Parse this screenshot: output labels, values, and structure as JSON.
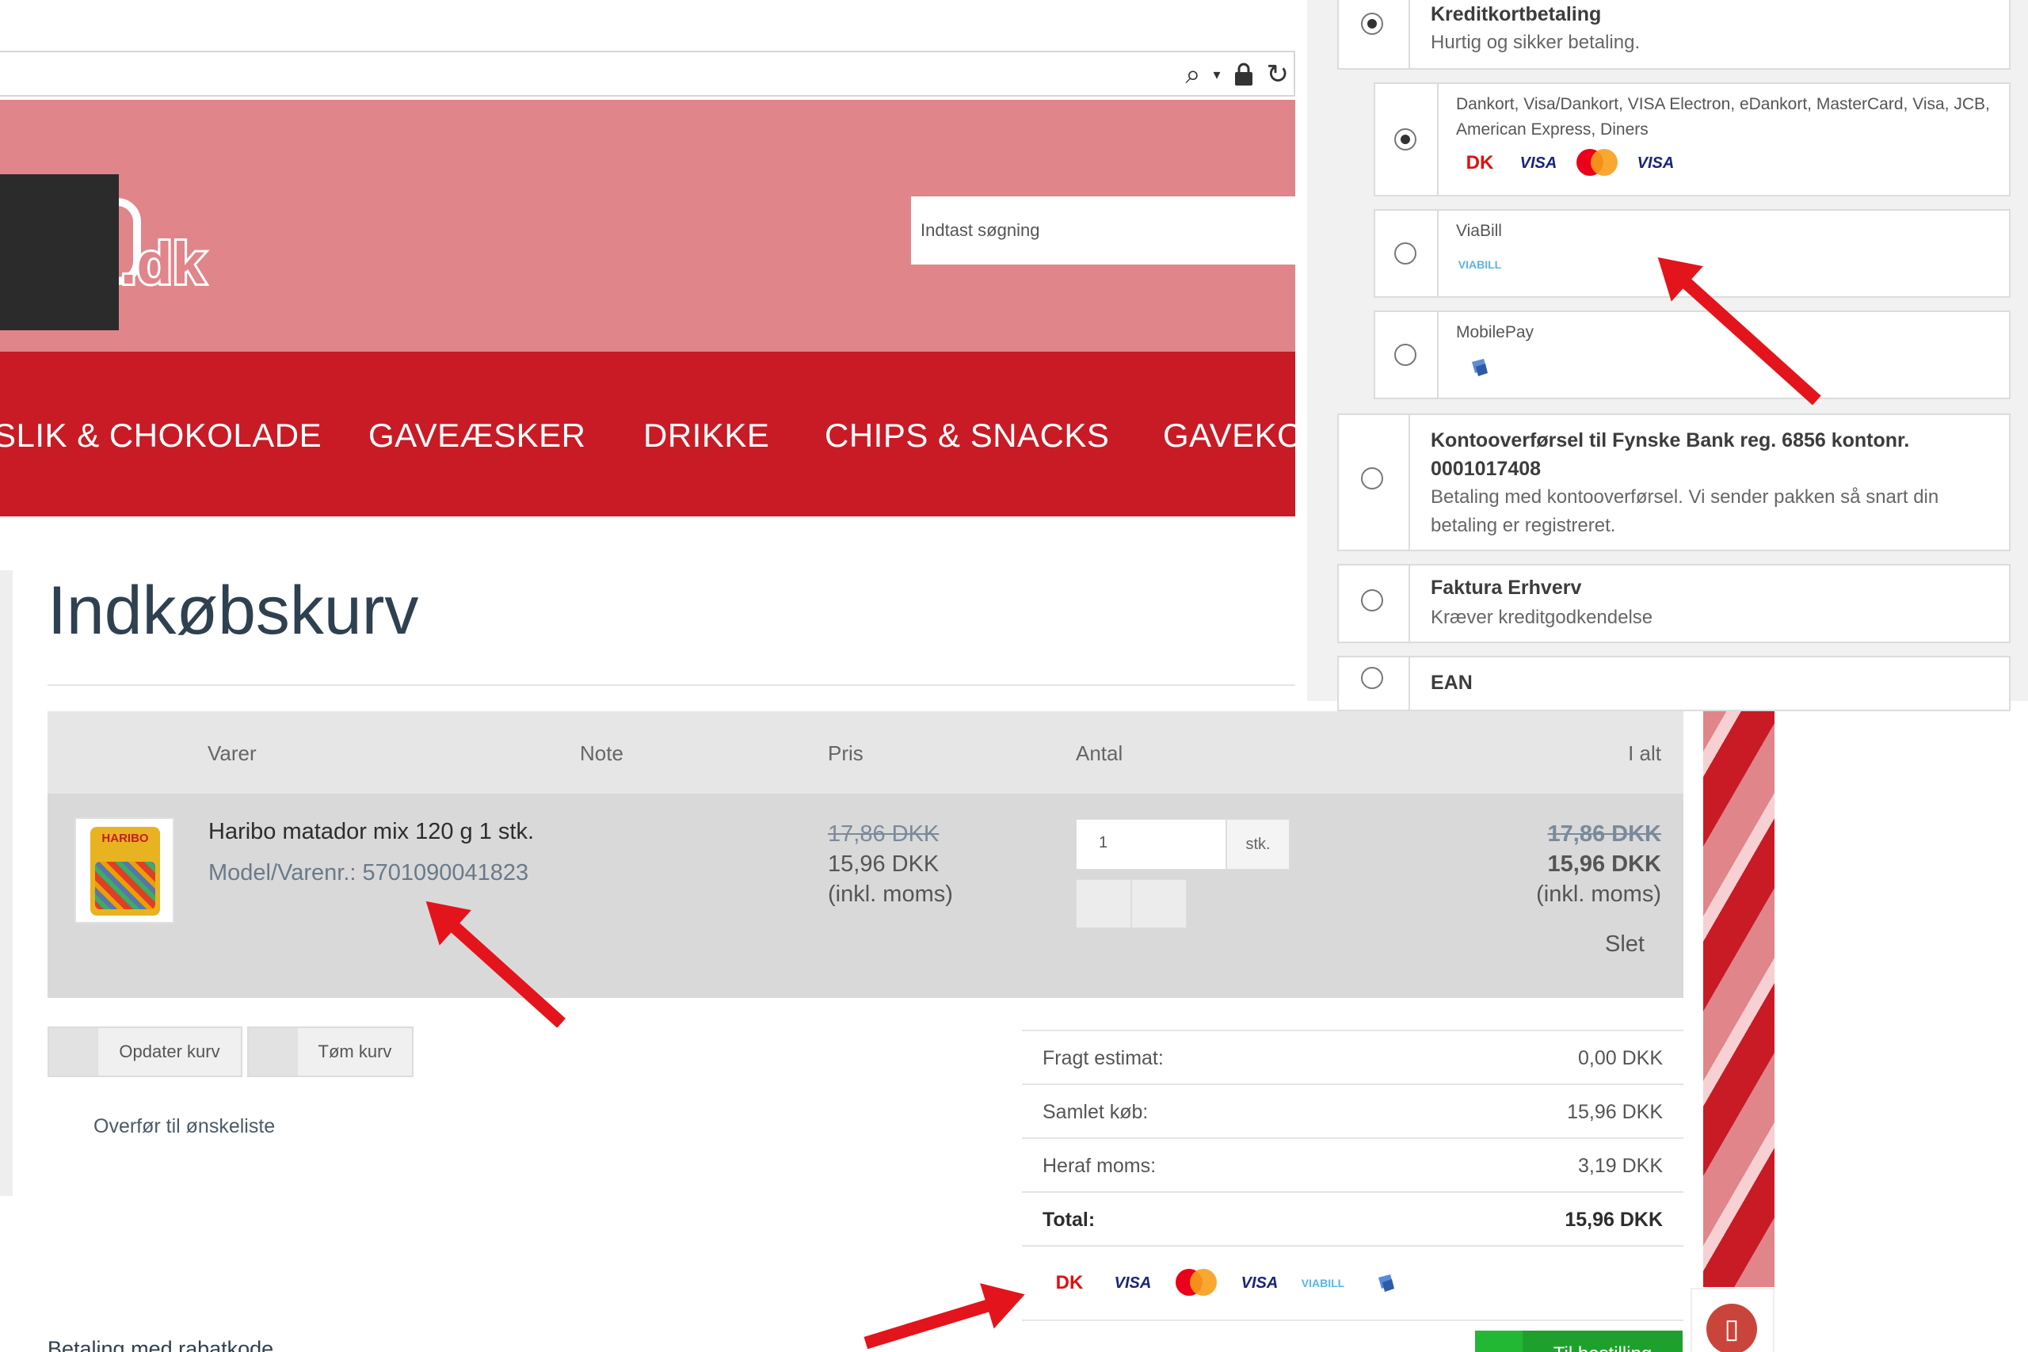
{
  "header": {
    "logo_text": ".dk",
    "search_placeholder": "Indtast søgning"
  },
  "nav": {
    "items": [
      "SLIK & CHOKOLADE",
      "GAVEÆSKER",
      "DRIKKE",
      "CHIPS & SNACKS",
      "GAVEKO"
    ]
  },
  "cart": {
    "title": "Indkøbskurv",
    "columns": [
      "Varer",
      "Note",
      "Pris",
      "Antal",
      "I alt"
    ],
    "item": {
      "image_brand": "HARIBO",
      "name": "Haribo matador mix 120 g 1 stk.",
      "model": "Model/Varenr.: 5701090041823",
      "old_price": "17,86 DKK",
      "price": "15,96 DKK",
      "vat_note": "(inkl. moms)",
      "quantity": "1",
      "unit": "stk.",
      "total_old": "17,86 DKK",
      "total": "15,96 DKK",
      "total_vat_note": "(inkl. moms)",
      "delete": "Slet"
    },
    "update_button": "Opdater kurv",
    "empty_button": "Tøm kurv",
    "wishlist_link": "Overfør til ønskeliste",
    "discount_label": "Betaling med rabatkode"
  },
  "summary": {
    "rows": [
      {
        "label": "Fragt estimat:",
        "value": "0,00 DKK"
      },
      {
        "label": "Samlet køb:",
        "value": "15,96 DKK"
      },
      {
        "label": "Heraf moms:",
        "value": "3,19 DKK"
      },
      {
        "label": "Total:",
        "value": "15,96 DKK"
      }
    ],
    "checkout_button": "Til bestilling"
  },
  "payment": {
    "card": {
      "title": "Kreditkortbetaling",
      "desc": "Hurtig og sikker betaling.",
      "selected": true
    },
    "card_types": "Dankort, Visa/Dankort, VISA Electron, eDankort, MasterCard, Visa, JCB, American Express, Diners",
    "viabill": "ViaBill",
    "mobilepay": "MobilePay",
    "transfer": {
      "title": "Kontooverførsel til Fynske Bank reg. 6856 kontonr. 0001017408",
      "desc": "Betaling med kontooverførsel. Vi sender pakken så snart din betaling er registreret."
    },
    "invoice": {
      "title": "Faktura Erhverv",
      "desc": "Kræver kreditgodkendelse"
    },
    "ean": {
      "title": "EAN"
    }
  },
  "icons": {
    "dankort": "DK",
    "visa": "VISA",
    "viabill": "VIABILL"
  },
  "colors": {
    "header_pink": "#e0858a",
    "nav_red": "#c81b25",
    "checkout_green": "#1ea12c",
    "arrow_red": "#e3141b"
  }
}
